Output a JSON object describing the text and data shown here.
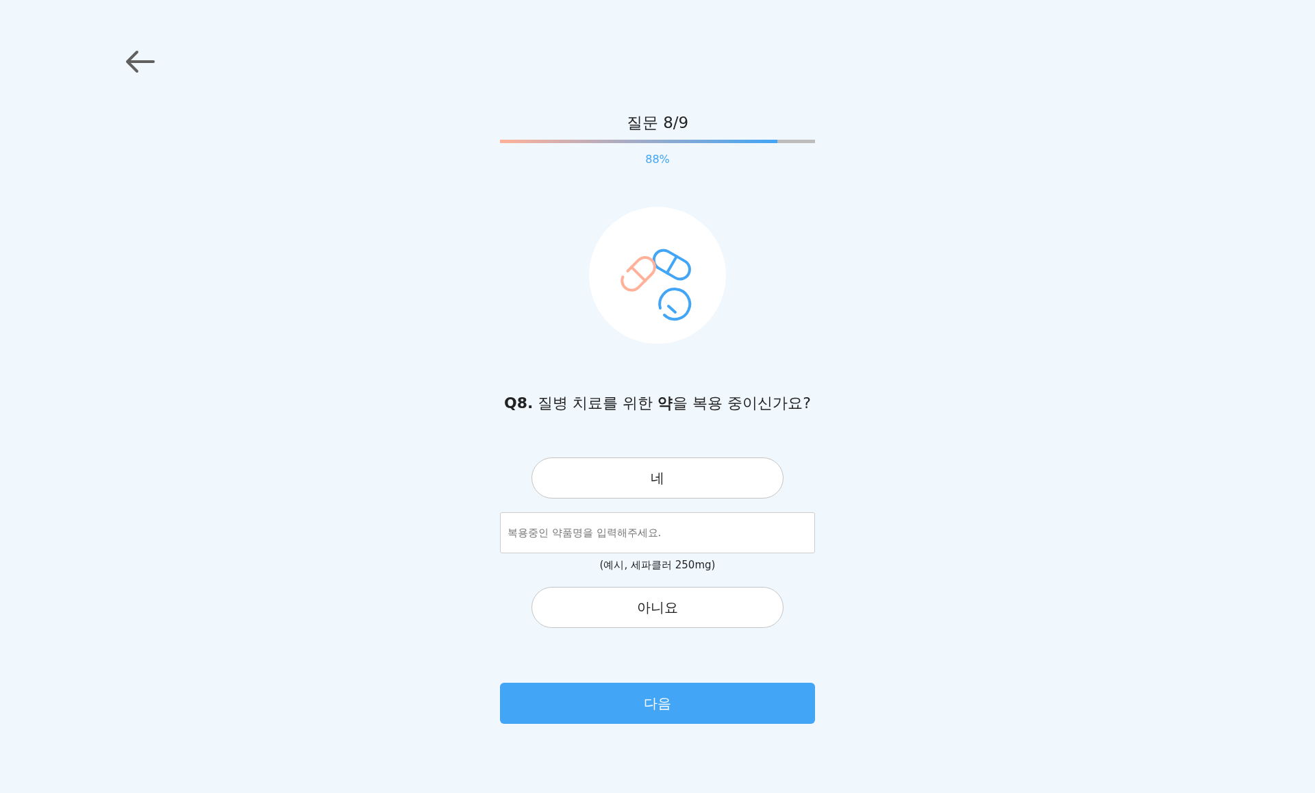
{
  "progress": {
    "title": "질문 8/9",
    "level": 0.88,
    "percent": "88%"
  },
  "question": "**Q8.** 질병 치료를 위한 **약**을 복용 중이신가요?",
  "answers": [
    {
      "label": "네",
      "selected": false,
      "input": {
        "placeholder": "복용중인 약품명을 입력해주세요.",
        "hint": "(예시, 세파클러 250mg)"
      }
    },
    {
      "label": "아니요",
      "selected": false
    }
  ],
  "next_button": "다음"
}
